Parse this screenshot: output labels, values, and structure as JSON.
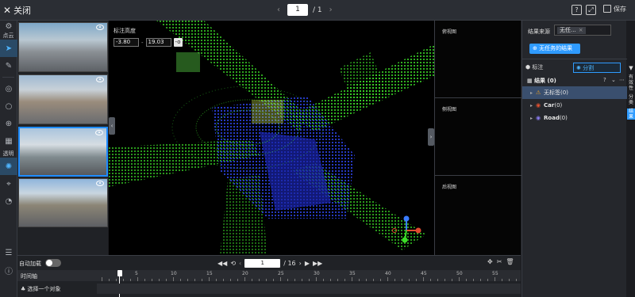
{
  "topbar": {
    "close_label": "关闭",
    "page_current": "1",
    "page_total": "/ 1",
    "help_icon": "question-icon",
    "fullscreen_icon": "fullscreen-icon",
    "save_label": "保存"
  },
  "tools": {
    "group1_label": "点云",
    "group2_label": "透明"
  },
  "height_filter": {
    "label": "标注高度",
    "min": "-3.80",
    "max": "19.03",
    "go": "-o"
  },
  "side_views": {
    "top": "俯视图",
    "side": "侧视图",
    "back": "后视图"
  },
  "result_panel": {
    "source_label": "结果来源",
    "source_chip": "无任...",
    "filter_button": "无任务的结果",
    "tab_annotate": "标注",
    "tab_segment": "分割",
    "results_title": "结果 (0)",
    "items": [
      {
        "label": "无标签",
        "count": "(0)",
        "color": "#f0a020"
      },
      {
        "label": "Car",
        "count": "(0)",
        "color": "#e4502f"
      },
      {
        "label": "Road",
        "count": "(0)",
        "color": "#8a7cf0"
      }
    ],
    "vertical_tabs": [
      "有效性",
      "分类",
      "结果"
    ]
  },
  "bottom": {
    "autoload_label": "自动加载",
    "frame_current": "1",
    "frame_total": "/ 16",
    "timeline_label": "时间轴",
    "ticks": [
      "5",
      "10",
      "15",
      "20",
      "25",
      "30",
      "35",
      "40",
      "45",
      "50",
      "55"
    ],
    "object_label": "选择一个对象"
  }
}
